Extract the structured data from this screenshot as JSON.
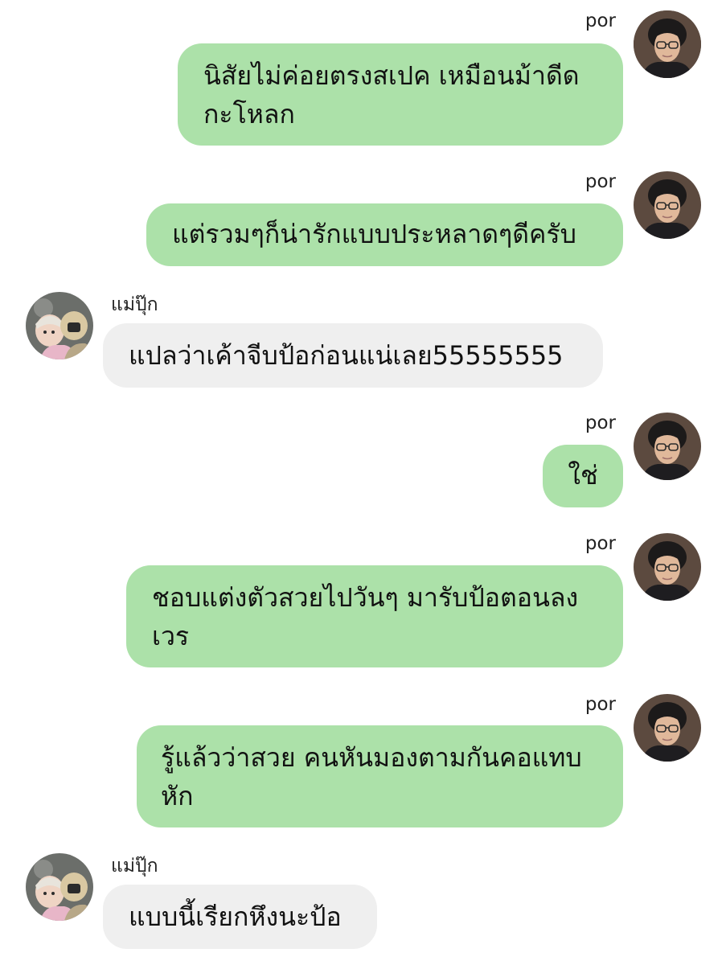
{
  "colors": {
    "outgoing_bubble": "#ace1a9",
    "incoming_bubble": "#efefef",
    "background": "#ffffff"
  },
  "messages": [
    {
      "sender": "por",
      "direction": "outgoing",
      "text": "นิสัยไม่ค่อยตรงสเปค เหมือนม้าดีดกะโหลก",
      "avatar_icon": "man-glasses-avatar-icon"
    },
    {
      "sender": "por",
      "direction": "outgoing",
      "text": "แต่รวมๆก็น่ารักแบบประหลาดๆดีครับ",
      "avatar_icon": "man-glasses-avatar-icon"
    },
    {
      "sender": "แม่ปุ๊ก",
      "direction": "incoming",
      "text": "แปลว่าเค้าจีบป้อก่อนแน่เลย55555555",
      "avatar_icon": "figurine-couple-avatar-icon"
    },
    {
      "sender": "por",
      "direction": "outgoing",
      "text": "ใช่",
      "avatar_icon": "man-glasses-avatar-icon"
    },
    {
      "sender": "por",
      "direction": "outgoing",
      "text": "ชอบแต่งตัวสวยไปวันๆ มารับป้อตอนลงเวร",
      "avatar_icon": "man-glasses-avatar-icon"
    },
    {
      "sender": "por",
      "direction": "outgoing",
      "text": "รู้แล้วว่าสวย คนหันมองตามกันคอแทบหัก",
      "avatar_icon": "man-glasses-avatar-icon"
    },
    {
      "sender": "แม่ปุ๊ก",
      "direction": "incoming",
      "text": "แบบนี้เรียกหึงนะป้อ",
      "avatar_icon": "figurine-couple-avatar-icon"
    }
  ]
}
